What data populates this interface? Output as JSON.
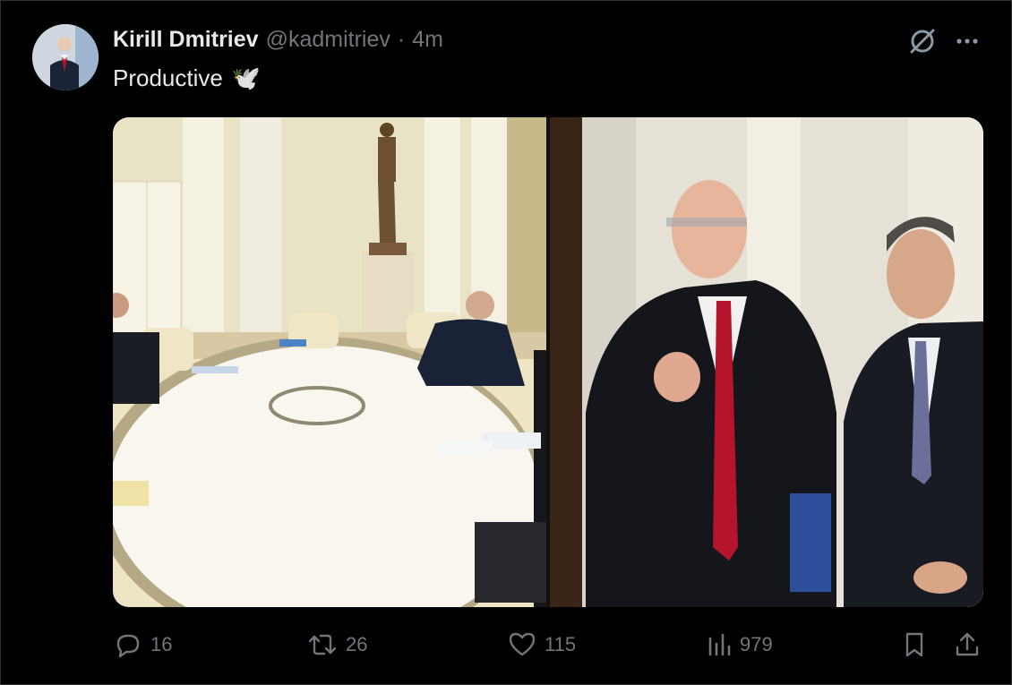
{
  "author": {
    "name": "Kirill Dmitriev",
    "handle": "@kadmitriev",
    "separator": "·",
    "time": "4m"
  },
  "tweet": {
    "text": "Productive",
    "emoji": "🕊️"
  },
  "header_icons": [
    "grok-icon",
    "more-icon"
  ],
  "media": [
    {
      "name": "photo-meeting-table"
    },
    {
      "name": "photo-two-men-standing"
    }
  ],
  "actions": {
    "replies": "16",
    "reposts": "26",
    "likes": "115",
    "views": "979"
  },
  "colors": {
    "background": "#000000",
    "text": "#e7e9ea",
    "muted": "#71767b",
    "border": "#2f3336"
  }
}
